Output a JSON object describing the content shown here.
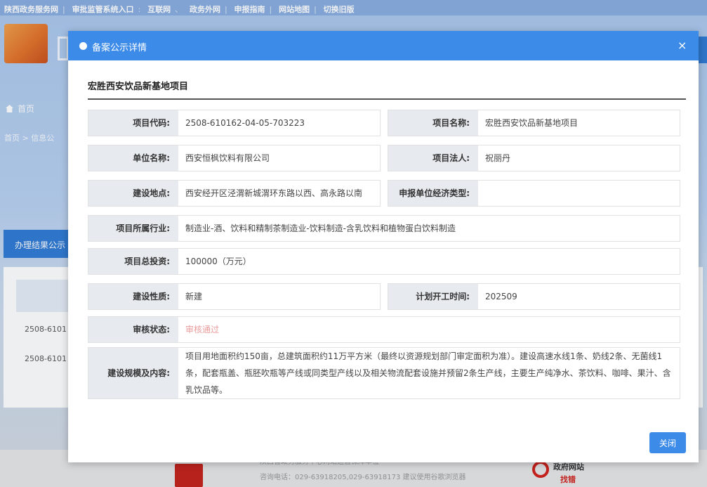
{
  "portal": {
    "top_links": [
      "陕西政务服务网",
      "审批监管系统入口",
      "互联网",
      "政务外网",
      "申报指南",
      "网站地图",
      "切换旧版"
    ],
    "nav_home": "首页",
    "breadcrumb": "首页 > 信息公",
    "result_tab": "办理结果公示",
    "table_rows": [
      "2508-6101",
      "2508-6101"
    ]
  },
  "modal": {
    "header_title": "备案公示详情",
    "close_glyph": "×",
    "project_title": "宏胜西安饮品新基地项目",
    "fields": {
      "project_code_label": "项目代码:",
      "project_code": "2508-610162-04-05-703223",
      "project_name_label": "项目名称:",
      "project_name": "宏胜西安饮品新基地项目",
      "org_name_label": "单位名称:",
      "org_name": "西安恒枫饮料有限公司",
      "legal_person_label": "项目法人:",
      "legal_person": "祝丽丹",
      "site_label": "建设地点:",
      "site": "西安经开区泾渭新城渭环东路以西、高永路以南",
      "econ_type_label": "申报单位经济类型:",
      "econ_type": "",
      "industry_label": "项目所属行业:",
      "industry": "制造业-酒、饮料和精制茶制造业-饮料制造-含乳饮料和植物蛋白饮料制造",
      "investment_label": "项目总投资:",
      "investment": "100000（万元）",
      "nature_label": "建设性质:",
      "nature": "新建",
      "start_time_label": "计划开工时间:",
      "start_time": "202509",
      "status_label": "审核状态:",
      "status": "审核通过",
      "scale_label": "建设规模及内容:",
      "scale": "项目用地面积约150亩，总建筑面积约11万平方米（最终以资源规划部门审定面积为准）。建设高速水线1条、奶线2条、无菌线1条，配套瓶盖、瓶胚吹瓶等产线或同类型产线以及相关物流配套设施并预留2条生产线，主要生产纯净水、茶饮料、咖啡、果汁、含乳饮品等。"
    },
    "close_button": "关闭"
  },
  "footer": {
    "line1": "陕西省政务服务中心网站运营保障单位",
    "line2": "咨询电话：029-63918205,029-63918173 建议使用谷歌浏览器",
    "find_error_title": "政府网站",
    "find_error_sub": "找错"
  },
  "colors": {
    "primary": "#3d8be8",
    "label_bg": "#e7eaee",
    "status_text": "#e57a7a"
  }
}
